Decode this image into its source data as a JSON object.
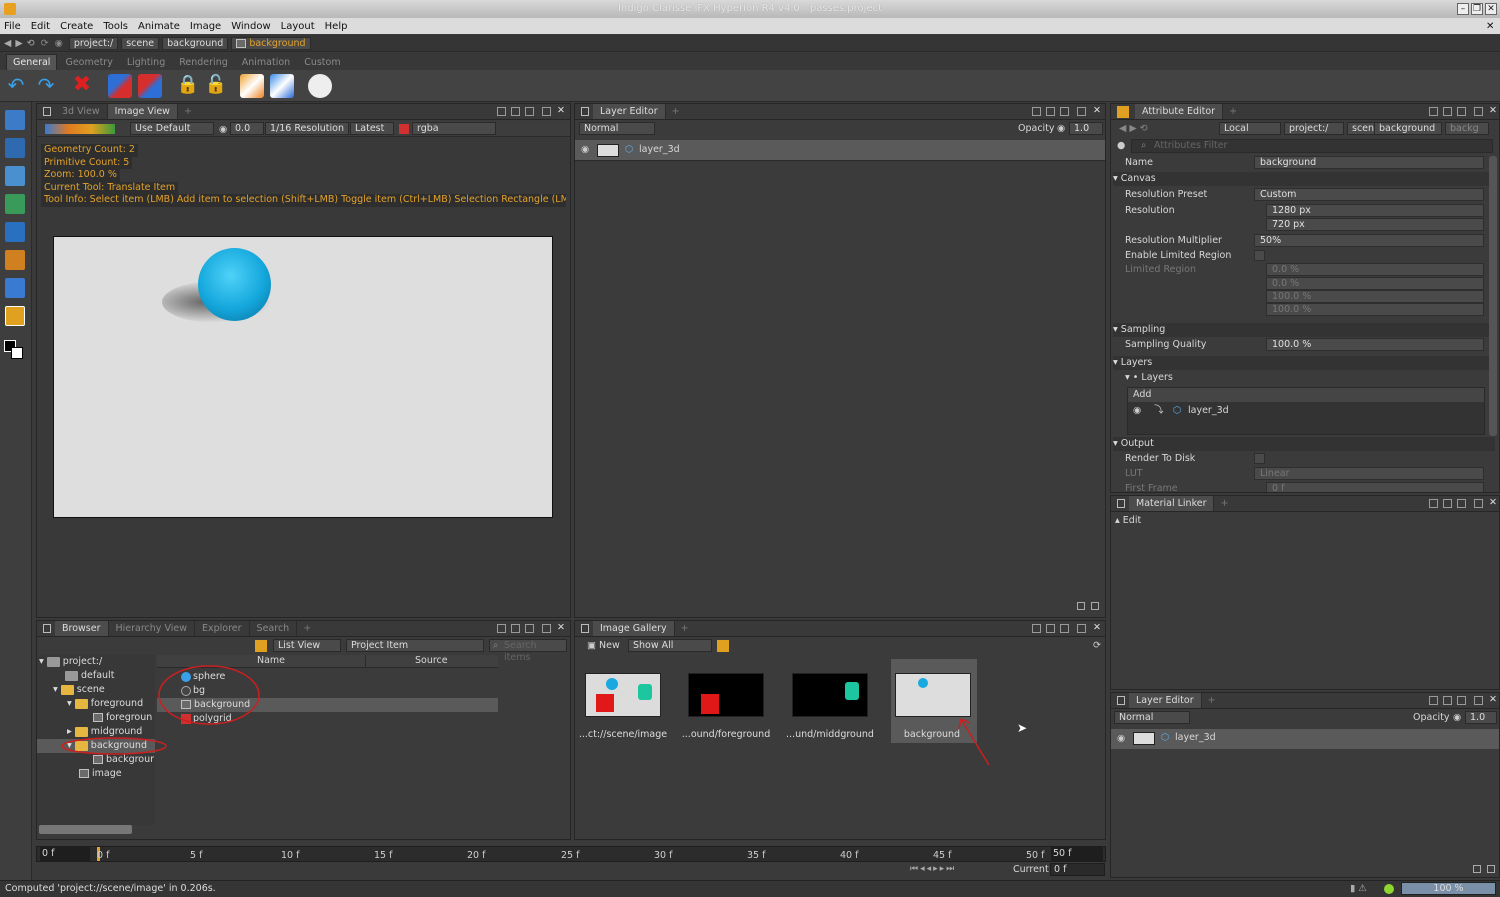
{
  "window": {
    "title": "Indigo Clarisse iFX Hyperion R4 v4.0 - passes.project"
  },
  "menu": [
    "File",
    "Edit",
    "Create",
    "Tools",
    "Animate",
    "Image",
    "Window",
    "Layout",
    "Help"
  ],
  "path": {
    "segments": [
      "project:/",
      "scene",
      "background"
    ],
    "current": "background"
  },
  "shelf_tabs": [
    "General",
    "Geometry",
    "Lighting",
    "Rendering",
    "Animation",
    "Custom"
  ],
  "viewport": {
    "tabs": [
      "3d View",
      "Image View"
    ],
    "toolbar": {
      "display": "Use Default",
      "exposure": "0.0",
      "resolution": "1/16 Resolution",
      "latest": "Latest",
      "channel": "rgba"
    },
    "overlay": [
      "Geometry Count: 2",
      "Primitive Count: 5",
      "Zoom: 100.0 %",
      "Current Tool: Translate Item",
      "Tool Info: Select item (LMB)  Add item to selection (Shift+LMB)  Toggle item (Ctrl+LMB)  Selection Rectangle (LMB-Drag"
    ]
  },
  "layer_editor": {
    "title": "Layer Editor",
    "blend": "Normal",
    "opacity_label": "Opacity",
    "opacity": "1.0",
    "layers": [
      "layer_3d"
    ]
  },
  "attribute_editor": {
    "title": "Attribute Editor",
    "space": "Local",
    "path": [
      "project:/",
      "scene",
      "background",
      "backg"
    ],
    "filter_placeholder": "Attributes Filter",
    "name_label": "Name",
    "name_value": "background",
    "sections": {
      "canvas": "Canvas",
      "sampling": "Sampling",
      "layers": "Layers",
      "output": "Output"
    },
    "rows": {
      "resolution_preset": {
        "label": "Resolution Preset",
        "value": "Custom"
      },
      "resolution": {
        "label": "Resolution",
        "w": "1280 px",
        "h": "720 px"
      },
      "resolution_multiplier": {
        "label": "Resolution Multiplier",
        "value": "50%"
      },
      "enable_limited_region": {
        "label": "Enable Limited Region"
      },
      "limited_region": {
        "label": "Limited Region",
        "values": [
          "0.0 %",
          "0.0 %",
          "100.0 %",
          "100.0 %"
        ]
      },
      "sampling_quality": {
        "label": "Sampling Quality",
        "value": "100.0 %"
      },
      "layers_sub": "Layers",
      "layers_add": "Add",
      "layers_item": "layer_3d",
      "render_to_disk": {
        "label": "Render To Disk"
      },
      "lut": {
        "label": "LUT",
        "value": "Linear"
      },
      "first_frame": {
        "label": "First Frame",
        "value": "0 f"
      }
    }
  },
  "material_linker": {
    "title": "Material Linker",
    "edit": "Edit"
  },
  "layer_editor2": {
    "title": "Layer Editor",
    "blend": "Normal",
    "opacity_label": "Opacity",
    "opacity": "1.0",
    "layer": "layer_3d"
  },
  "browser": {
    "tabs": [
      "Browser",
      "Hierarchy View",
      "Explorer",
      "Search"
    ],
    "view_mode": "List View",
    "filter": "Project Item",
    "search_placeholder": "Search items",
    "tree": [
      {
        "label": "project:/",
        "depth": 0
      },
      {
        "label": "default",
        "depth": 1
      },
      {
        "label": "scene",
        "depth": 1
      },
      {
        "label": "foreground",
        "depth": 2
      },
      {
        "label": "foregroun",
        "depth": 3
      },
      {
        "label": "midground",
        "depth": 2
      },
      {
        "label": "background",
        "depth": 2
      },
      {
        "label": "backgrour",
        "depth": 3
      },
      {
        "label": "image",
        "depth": 2
      }
    ],
    "columns": [
      "Name",
      "Source"
    ],
    "items": [
      "sphere",
      "bg",
      "background",
      "polygrid"
    ]
  },
  "gallery": {
    "title": "Image Gallery",
    "new": "New",
    "filter": "Show All",
    "thumbs": [
      "...ct://scene/image",
      "...ound/foreground",
      "...und/middground",
      "background"
    ]
  },
  "timeline": {
    "start": "0 f",
    "end": "50 f",
    "ticks": [
      "0 f",
      "5 f",
      "10 f",
      "15 f",
      "20 f",
      "25 f",
      "30 f",
      "35 f",
      "40 f",
      "45 f",
      "50 f"
    ],
    "current_label": "Current",
    "current": "0 f"
  },
  "status": {
    "message": "Computed 'project://scene/image' in 0.206s.",
    "progress": "100 %"
  },
  "colors": {
    "accent": "#e4a22a",
    "sphere": "#1ab3e0",
    "annotation": "#cc1f1f"
  }
}
